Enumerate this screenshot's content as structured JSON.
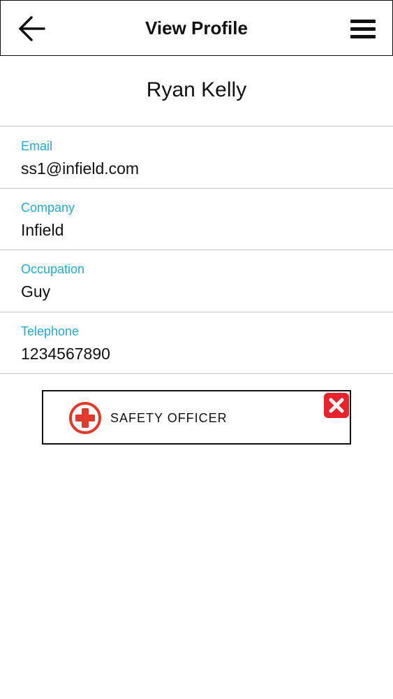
{
  "header": {
    "title": "View Profile",
    "back_icon": "arrow-left-icon",
    "menu_icon": "hamburger-menu-icon"
  },
  "profile": {
    "name": "Ryan Kelly",
    "fields": [
      {
        "label": "Email",
        "value": "ss1@infield.com"
      },
      {
        "label": "Company",
        "value": "Infield"
      },
      {
        "label": "Occupation",
        "value": "Guy"
      },
      {
        "label": "Telephone",
        "value": "1234567890"
      }
    ]
  },
  "role": {
    "label": "SAFETY OFFICER",
    "icon": "medical-cross-icon",
    "remove_icon": "close-icon"
  },
  "colors": {
    "label_accent": "#2aa8c9",
    "role_icon_red": "#e23b2e",
    "remove_red": "#e8232e"
  }
}
